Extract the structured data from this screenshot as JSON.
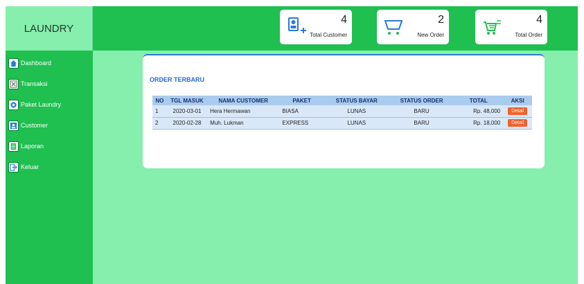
{
  "app": {
    "brand": "LAUNDRY"
  },
  "menu": [
    {
      "label": "Dashboard",
      "icon": "home-icon"
    },
    {
      "label": "Transaksi",
      "icon": "transaction-icon"
    },
    {
      "label": "Paket Laundry",
      "icon": "package-icon"
    },
    {
      "label": "Customer",
      "icon": "customer-icon"
    },
    {
      "label": "Laporan",
      "icon": "report-icon"
    },
    {
      "label": "Keluar",
      "icon": "logout-icon"
    }
  ],
  "stats": [
    {
      "value": "4",
      "label": "Total Customer",
      "icon": "add-user-icon"
    },
    {
      "value": "2",
      "label": "New Order",
      "icon": "cart-icon"
    },
    {
      "value": "4",
      "label": "Total Order",
      "icon": "cart-list-icon"
    }
  ],
  "orders": {
    "title": "ORDER TERBARU",
    "headers": [
      "NO",
      "TGL MASUK",
      "NAMA CUSTOMER",
      "PAKET",
      "STATUS BAYAR",
      "STATUS ORDER",
      "TOTAL",
      "AKSI"
    ],
    "rows": [
      {
        "no": "1",
        "tgl": "2020-03-01",
        "nama": "Hera Hermawan",
        "paket": "BIASA",
        "bayar": "LUNAS",
        "status": "BARU",
        "total": "Rp. 48,000",
        "aksi": "Detail"
      },
      {
        "no": "2",
        "tgl": "2020-02-28",
        "nama": "Muh. Lukman",
        "paket": "EXPRESS",
        "bayar": "LUNAS",
        "status": "BARU",
        "total": "Rp. 18,000",
        "aksi": "Detail"
      }
    ]
  },
  "colors": {
    "sidebar": "#1fbf50",
    "background": "#86efad",
    "accent": "#1f6bd4",
    "button": "#f2612a"
  }
}
